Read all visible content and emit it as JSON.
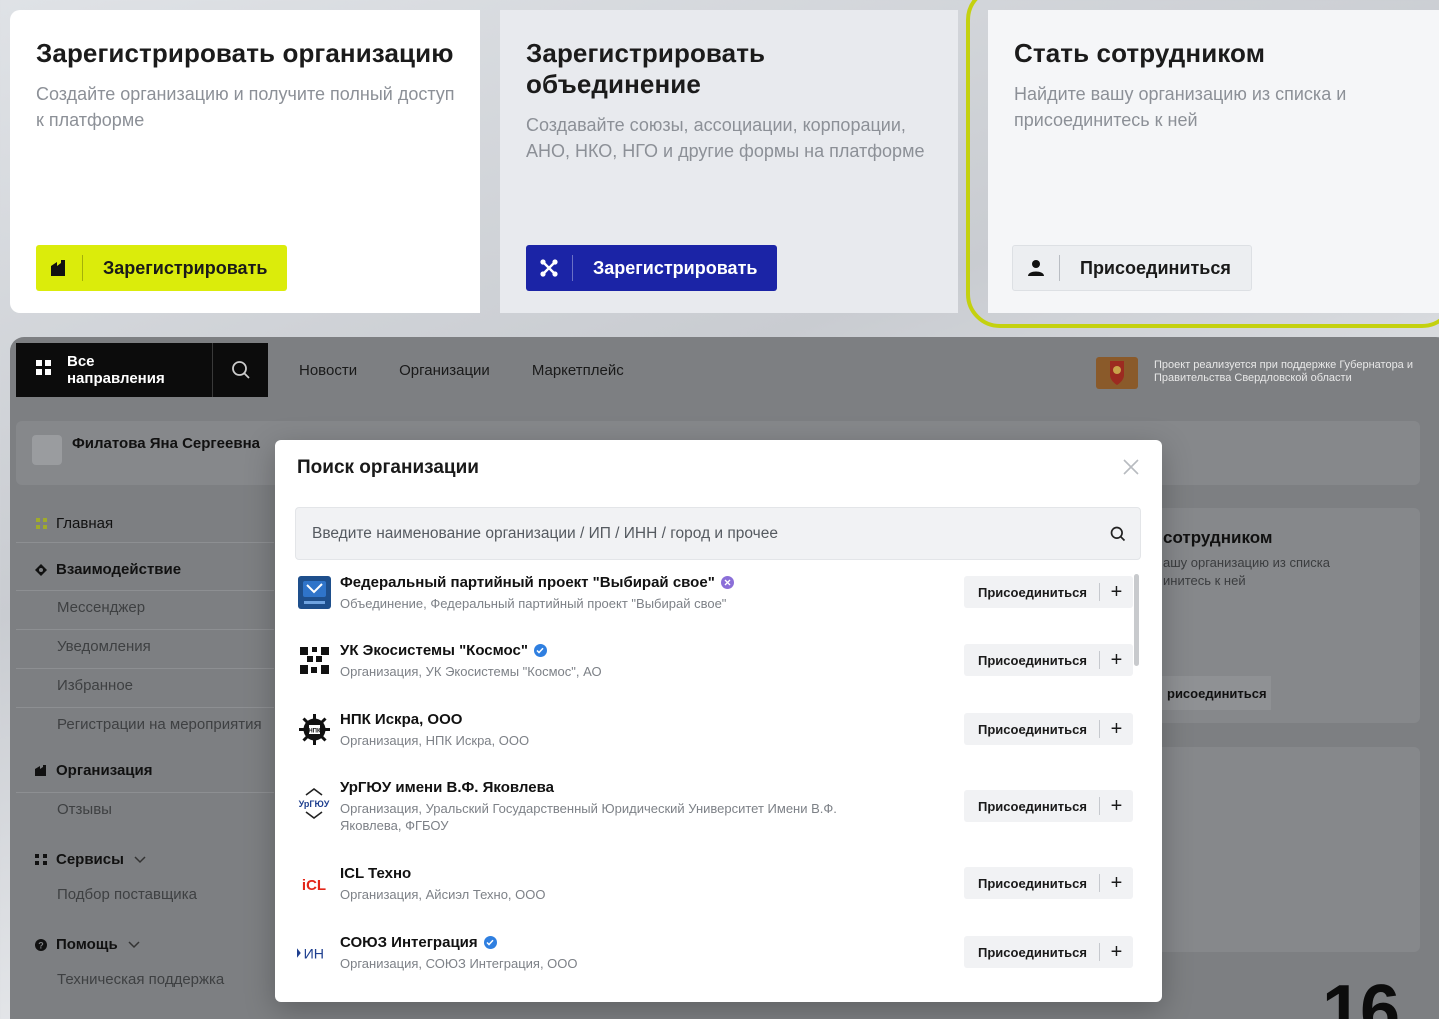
{
  "cards": [
    {
      "title": "Зарегистрировать организацию",
      "desc": "Создайте организацию и получите полный доступ к платформе",
      "button": "Зарегистрировать",
      "button_icon": "building-icon",
      "accent": "#dbec0b"
    },
    {
      "title": "Зарегистрировать объединение",
      "desc": "Создавайте союзы, ассоциации, корпорации, АНО, НКО, НГО и другие формы на платформе",
      "button": "Зарегистрировать",
      "button_icon": "network-icon",
      "accent": "#1b24a6"
    },
    {
      "title": "Стать сотрудником",
      "desc": "Найдите вашу организацию из списка и присоединитесь к ней",
      "button": "Присоединиться",
      "button_icon": "person-icon",
      "accent": "#c4d10f"
    }
  ],
  "topbar": {
    "all_directions": "Все направления",
    "nav": [
      "Новости",
      "Организации",
      "Маркетплейс"
    ],
    "gov_text": "Проект реализуется при поддержке Губернатора и Правительства Свердловской области"
  },
  "profile": {
    "name": "Филатова Яна Сергеевна"
  },
  "sidebar": {
    "home": "Главная",
    "interaction": "Взаимодействие",
    "interaction_items": [
      "Мессенджер",
      "Уведомления",
      "Избранное",
      "Регистрации на мероприятия"
    ],
    "organization": "Организация",
    "organization_items": [
      "Отзывы"
    ],
    "services": "Сервисы",
    "services_items": [
      "Подбор поставщика"
    ],
    "help": "Помощь",
    "help_items": [
      "Техническая поддержка"
    ]
  },
  "background_card": {
    "title": "сотрудником",
    "desc": "ашу организацию из списка инитесь к ней",
    "button": "рисоединиться"
  },
  "page_number": "16",
  "modal": {
    "title": "Поиск организации",
    "search_placeholder": "Введите наименование организации / ИП / ИНН / город и прочее",
    "join_label": "Присоединиться",
    "orgs": [
      {
        "name": "Федеральный партийный проект \"Выбирай свое\"",
        "sub": "Объединение, Федеральный партийный проект \"Выбирай свое\"",
        "badge": "purple"
      },
      {
        "name": "УК Экосистемы \"Космос\"",
        "sub": "Организация, УК Экосистемы \"Космос\", АО",
        "badge": "blue"
      },
      {
        "name": "НПК Искра, ООО",
        "sub": "Организация, НПК Искра, ООО",
        "badge": ""
      },
      {
        "name": "УрГЮУ имени В.Ф. Яковлева",
        "sub": "Организация, Уральский Государственный Юридический Университет Имени В.Ф. Яковлева, ФГБОУ",
        "badge": ""
      },
      {
        "name": "ICL Техно",
        "sub": "Организация, Айсиэл Техно, ООО",
        "badge": ""
      },
      {
        "name": "СОЮЗ Интеграция",
        "sub": "Организация, СОЮЗ Интеграция, ООО",
        "badge": "blue"
      }
    ],
    "logo_texts": {
      "urgyu": "УрГЮУ",
      "icl": "iCL",
      "integ": "ИН"
    }
  },
  "colors": {
    "verified_blue": "#2f7fe0",
    "verified_purple": "#8b6fd8",
    "brand_yellow": "#dbec0b",
    "brand_blue": "#1b24a6"
  }
}
